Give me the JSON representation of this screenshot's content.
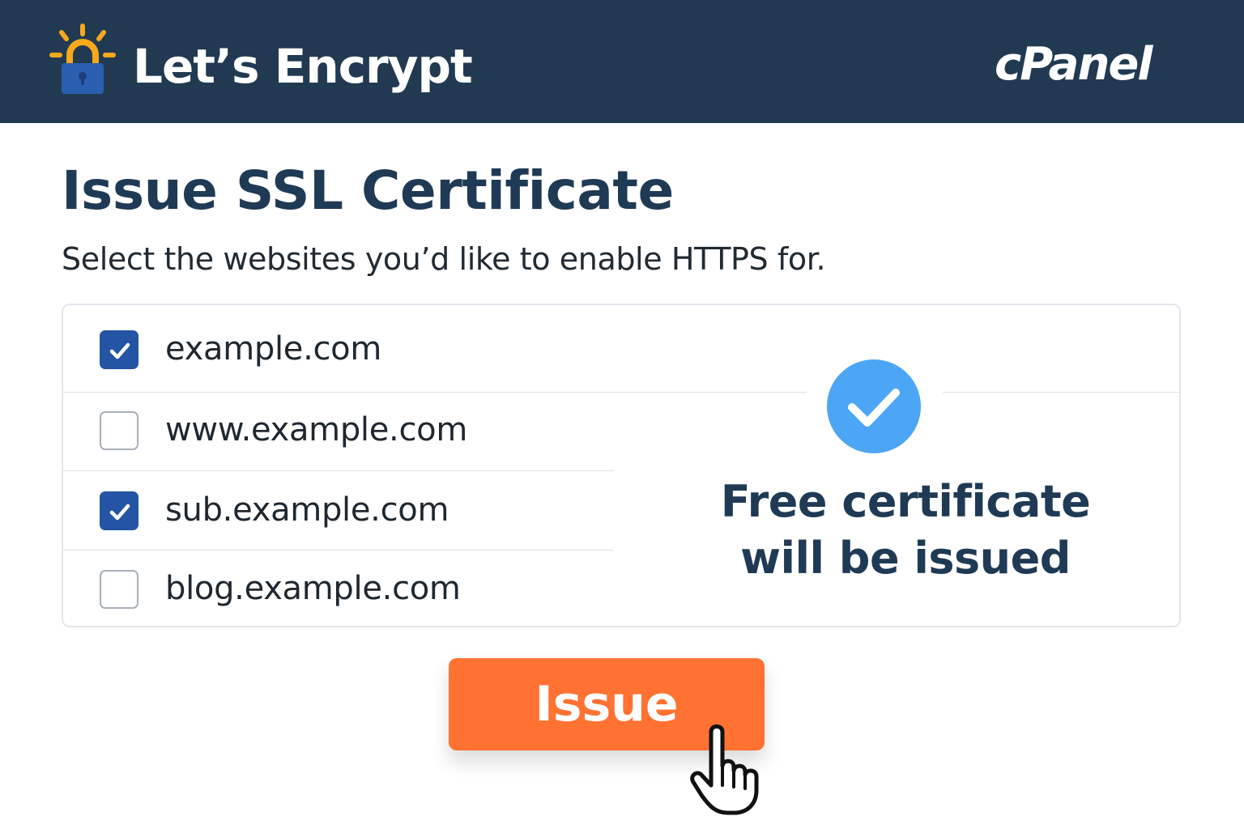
{
  "header": {
    "app_title": "Let’s Encrypt",
    "brand_logo_text": "cPanel",
    "logo_icon": "padlock-sunburst-icon",
    "background_color": "#213a52"
  },
  "main": {
    "title": "Issue SSL Certificate",
    "subtitle": "Select the websites you’d like to enable HTTPS for."
  },
  "domains": [
    {
      "label": "example.com",
      "checked": true
    },
    {
      "label": "www.example.com",
      "checked": false
    },
    {
      "label": "sub.example.com",
      "checked": true
    },
    {
      "label": "blog.example.com",
      "checked": false
    }
  ],
  "status": {
    "icon": "check-circle-icon",
    "line1": "Free certificate",
    "line2": "will be issued",
    "badge_color": "#4da6f5"
  },
  "actions": {
    "issue_label": "Issue",
    "issue_color": "#ff7232"
  },
  "colors": {
    "accent": "#2455a4",
    "heading": "#1f3a55"
  }
}
